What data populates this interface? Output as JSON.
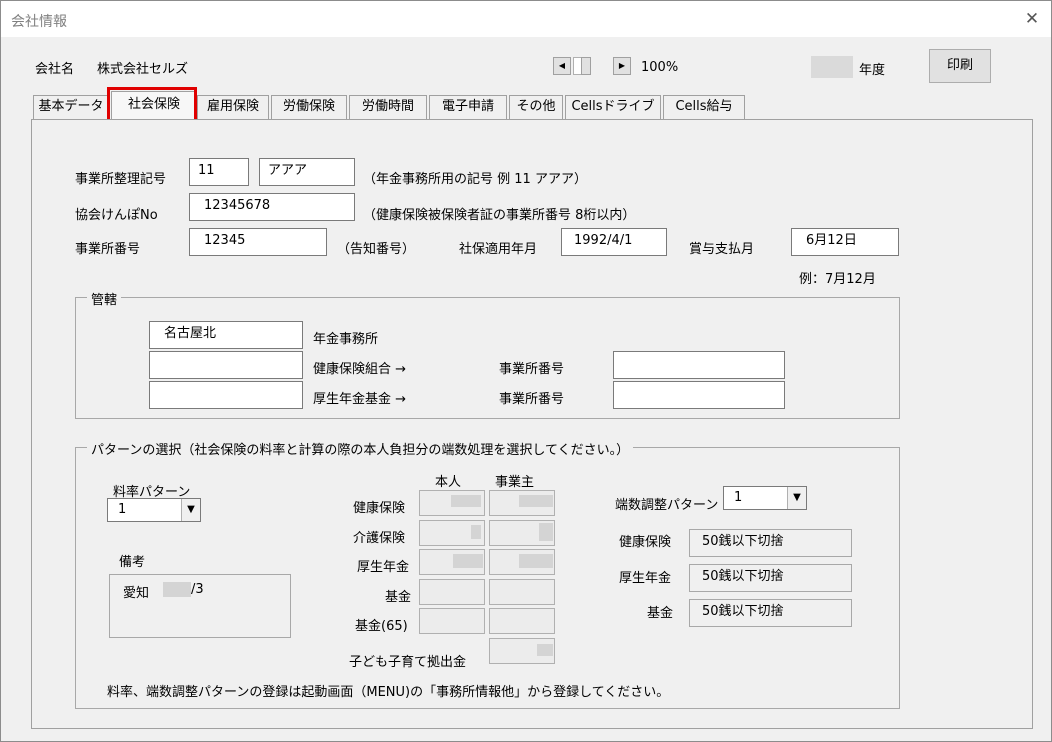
{
  "window": {
    "title": "会社情報"
  },
  "header": {
    "company_label": "会社名",
    "company_name": "株式会社セルズ",
    "zoom": "100%",
    "year_suffix": "年度",
    "print_button": "印刷"
  },
  "tabs": [
    {
      "label": "基本データ"
    },
    {
      "label": "社会保険"
    },
    {
      "label": "雇用保険"
    },
    {
      "label": "労働保険"
    },
    {
      "label": "労働時間"
    },
    {
      "label": "電子申請"
    },
    {
      "label": "その他"
    },
    {
      "label": "Cellsドライブ"
    },
    {
      "label": "Cells給与"
    }
  ],
  "office": {
    "code_label": "事業所整理記号",
    "code_num": "11",
    "code_kana": "アアア",
    "code_note": "（年金事務所用の記号  例  11 アアア）",
    "kenpo_label": "協会けんぽNo",
    "kenpo_value": "12345678",
    "kenpo_note": "（健康保険被保険者証の事業所番号  8桁以内）",
    "office_no_label": "事業所番号",
    "office_no_value": "12345",
    "office_no_note": "（告知番号）",
    "apply_label": "社保適用年月",
    "apply_value": "1992/4/1",
    "bonus_label": "賞与支払月",
    "bonus_value": "6月12日",
    "bonus_example": "例：7月12月"
  },
  "jurisdiction": {
    "legend": "管轄",
    "pension_office_value": "名古屋北",
    "pension_office_label": "年金事務所",
    "health_union_label": "健康保険組合 →",
    "pension_fund_label": "厚生年金基金 →",
    "office_no_label_1": "事業所番号",
    "office_no_label_2": "事業所番号"
  },
  "pattern": {
    "legend": "パターンの選択（社会保険の料率と計算の際の本人負担分の端数処理を選択してください。）",
    "rate_pattern_label": "料率パターン",
    "rate_pattern_value": "1",
    "remarks_label": "備考",
    "remarks_value_pre": "愛知",
    "remarks_value_post": "/3",
    "col_self": "本人",
    "col_employer": "事業主",
    "rows": [
      "健康保険",
      "介護保険",
      "厚生年金",
      "基金",
      "基金(65)",
      "子ども子育て拠出金"
    ],
    "rounding_label": "端数調整パターン",
    "rounding_value": "1",
    "rounding_rows": [
      {
        "label": "健康保険",
        "value": "50銭以下切捨"
      },
      {
        "label": "厚生年金",
        "value": "50銭以下切捨"
      },
      {
        "label": "基金",
        "value": "50銭以下切捨"
      }
    ],
    "footer_note": "料率、端数調整パターンの登録は起動画面（MENU)の「事務所情報他」から登録してください。"
  }
}
